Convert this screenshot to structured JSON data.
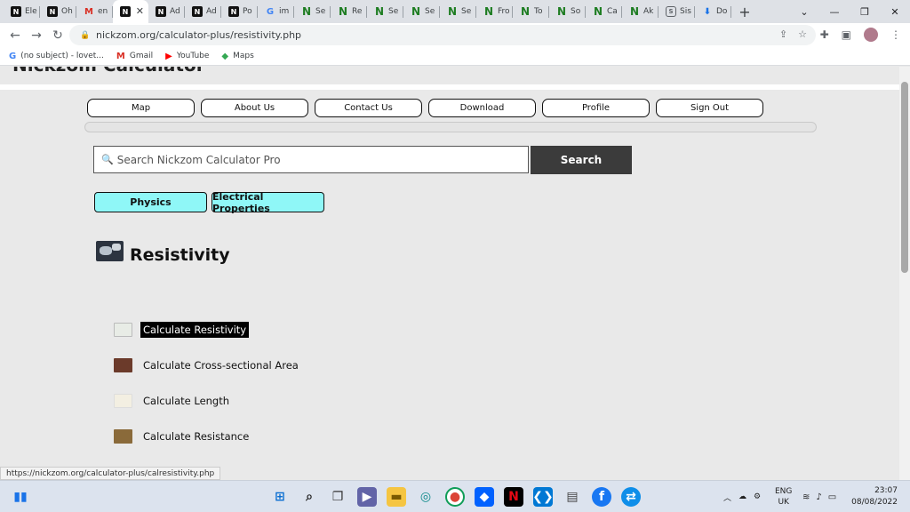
{
  "browser": {
    "tabs": [
      {
        "label": "Ele",
        "icon": "nickzom-favicon"
      },
      {
        "label": "Oh",
        "icon": "nickzom-favicon"
      },
      {
        "label": "en",
        "icon": "gmail-favicon"
      },
      {
        "label": "",
        "icon": "nickzom-favicon",
        "active": true
      },
      {
        "label": "Ad",
        "icon": "nickzom-favicon"
      },
      {
        "label": "Ad",
        "icon": "nickzom-favicon"
      },
      {
        "label": "Po",
        "icon": "nickzom-favicon"
      },
      {
        "label": "im",
        "icon": "google-favicon"
      },
      {
        "label": "Se",
        "icon": "n-favicon"
      },
      {
        "label": "Re",
        "icon": "n-favicon"
      },
      {
        "label": "Se",
        "icon": "n-favicon"
      },
      {
        "label": "Se",
        "icon": "n-favicon"
      },
      {
        "label": "Se",
        "icon": "n-favicon"
      },
      {
        "label": "Fro",
        "icon": "n-favicon"
      },
      {
        "label": "To",
        "icon": "n-favicon"
      },
      {
        "label": "So",
        "icon": "n-favicon"
      },
      {
        "label": "Ca",
        "icon": "n-favicon"
      },
      {
        "label": "Ak",
        "icon": "n-favicon"
      },
      {
        "label": "Sis",
        "icon": "sis-favicon"
      },
      {
        "label": "Do",
        "icon": "download-favicon"
      }
    ],
    "new_tab": "+",
    "url": "nickzom.org/calculator-plus/resistivity.php",
    "bookmarks": [
      {
        "label": "(no subject) - lovet...",
        "icon": "google-icon"
      },
      {
        "label": "Gmail",
        "icon": "gmail-icon"
      },
      {
        "label": "YouTube",
        "icon": "youtube-icon"
      },
      {
        "label": "Maps",
        "icon": "maps-icon"
      }
    ],
    "status_url": "https://nickzom.org/calculator-plus/calresistivity.php"
  },
  "page": {
    "site_title": "Nickzom Calculator",
    "menu": [
      "Map",
      "About Us",
      "Contact Us",
      "Download",
      "Profile",
      "Sign Out"
    ],
    "search": {
      "placeholder": "Search Nickzom Calculator Pro",
      "button": "Search"
    },
    "categories": [
      "Physics",
      "Electrical Properties"
    ],
    "heading": "Resistivity",
    "items": [
      {
        "label": "Calculate Resistivity",
        "selected": true,
        "color": "#e8ece6"
      },
      {
        "label": "Calculate Cross-sectional Area",
        "selected": false,
        "color": "#6b3a2a"
      },
      {
        "label": "Calculate Length",
        "selected": false,
        "color": "#f3efe2"
      },
      {
        "label": "Calculate Resistance",
        "selected": false,
        "color": "#8a6a3a"
      }
    ]
  },
  "taskbar": {
    "lang_top": "ENG",
    "lang_bottom": "UK",
    "time": "23:07",
    "date": "08/08/2022"
  }
}
